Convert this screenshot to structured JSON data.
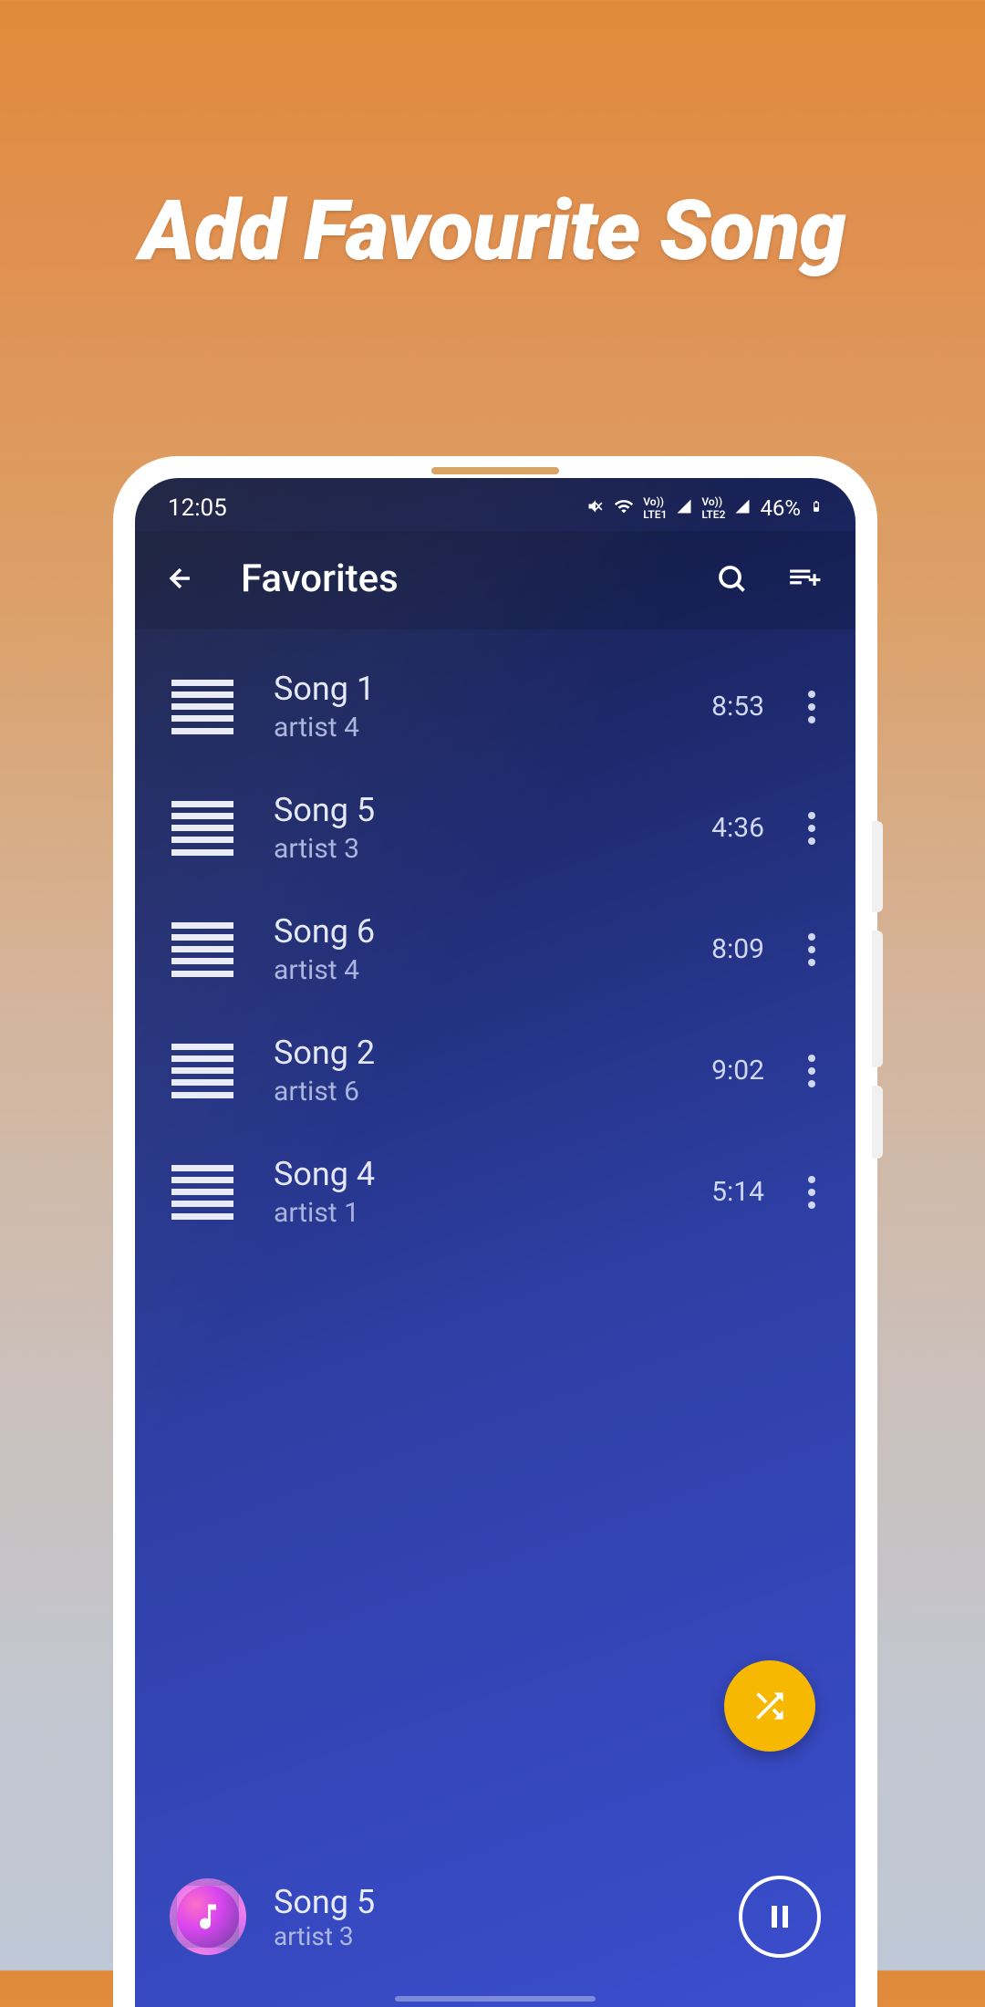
{
  "headline": "Add Favourite Song",
  "status": {
    "time": "12:05",
    "battery": "46%",
    "indicators": "LTE1 LTE2"
  },
  "appbar": {
    "title": "Favorites"
  },
  "songs": [
    {
      "title": "Song 1",
      "artist": "artist 4",
      "duration": "8:53"
    },
    {
      "title": "Song 5",
      "artist": "artist 3",
      "duration": "4:36"
    },
    {
      "title": "Song 6",
      "artist": "artist 4",
      "duration": "8:09"
    },
    {
      "title": "Song 2",
      "artist": "artist 6",
      "duration": "9:02"
    },
    {
      "title": "Song 4",
      "artist": "artist 1",
      "duration": "5:14"
    }
  ],
  "now_playing": {
    "title": "Song 5",
    "artist": "artist 3"
  }
}
